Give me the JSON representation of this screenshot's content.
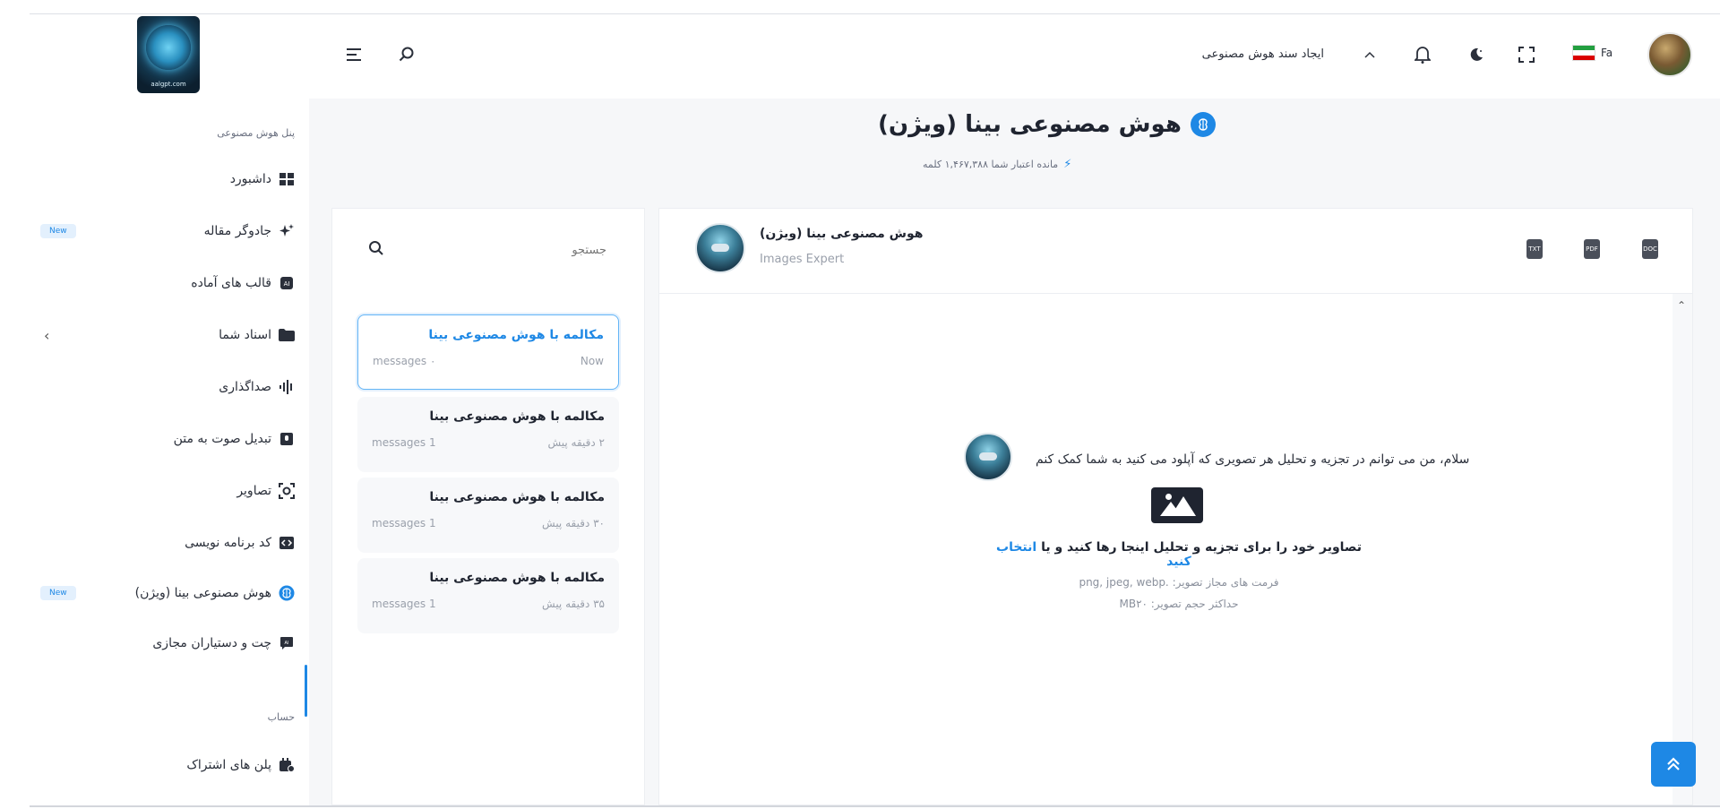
{
  "logo": {
    "caption": "aalgpt.com"
  },
  "header": {
    "create_doc_label": "ایجاد سند هوش مصنوعی",
    "lang": "Fa"
  },
  "sidebar": {
    "section_ai": "پنل هوش مصنوعی",
    "items": [
      {
        "label": "داشبورد",
        "icon": "dashboard-icon"
      },
      {
        "label": "جادوگر مقاله",
        "icon": "sparkles-icon",
        "badge": "New"
      },
      {
        "label": "قالب های آماده",
        "icon": "ai-template-icon"
      },
      {
        "label": "اسناد شما",
        "icon": "folder-icon"
      },
      {
        "label": "صداگذاری",
        "icon": "voice-wave-icon"
      },
      {
        "label": "تبدیل صوت به متن",
        "icon": "speech-to-text-icon"
      },
      {
        "label": "تصاویر",
        "icon": "image-scan-icon"
      },
      {
        "label": "کد برنامه نویسی",
        "icon": "code-icon"
      },
      {
        "label": "هوش مصنوعی بینا (ویژن)",
        "icon": "brain-icon",
        "badge": "New"
      },
      {
        "label": "چت و دستیاران مجازی",
        "icon": "chat-bot-icon"
      }
    ],
    "section_account": "حساب",
    "account_items": [
      {
        "label": "پلن های اشتراک",
        "icon": "subscription-icon"
      }
    ]
  },
  "page": {
    "title": "هوش مصنوعی بینا (ویژن)",
    "credit_label": "مانده اعتبار شما ۱,۴۶۷,۳۸۸ کلمه"
  },
  "chat_list": {
    "search_placeholder": "جستجو",
    "conversations": [
      {
        "title": "مکالمه با هوش مصنوعی بینا",
        "count": "۰ messages",
        "time": "Now"
      },
      {
        "title": "مکالمه با هوش مصنوعی بینا",
        "count": "1 messages",
        "time": "۲ دقیقه پیش"
      },
      {
        "title": "مکالمه با هوش مصنوعی بینا",
        "count": "1 messages",
        "time": "۳۰ دقیقه پیش"
      },
      {
        "title": "مکالمه با هوش مصنوعی بینا",
        "count": "1 messages",
        "time": "۳۵ دقیقه پیش"
      }
    ]
  },
  "chat": {
    "bot_name": "هوش مصنوعی بینا (ویژن)",
    "bot_role": "Images Expert",
    "greeting": "سلام، من می توانم در تجزیه و تحلیل هر تصویری که آپلود می کنید به شما کمک کنم",
    "upload_text": "تصاویر خود را برای تجزیه و تحلیل اینجا رها کنید و یا",
    "upload_link": "انتخاب کنید",
    "formats": "png, jpeg, webp. :فرمت های مجاز تصویر",
    "max_size": "MBحداکثر حجم تصویر: ۲۰"
  },
  "colors": {
    "accent": "#1e88e5",
    "badge_bg": "#e3f0fd",
    "panel_bg": "#f6f7f9"
  }
}
